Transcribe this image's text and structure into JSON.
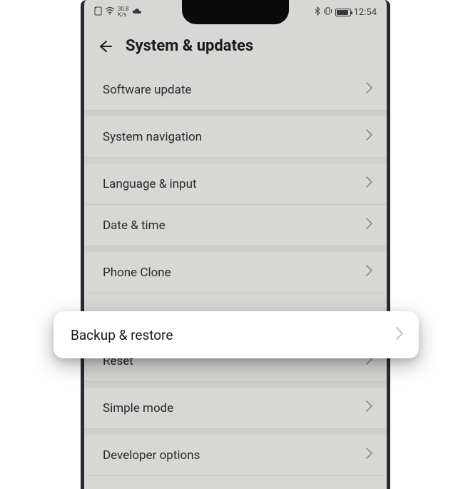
{
  "status": {
    "speed_top": "30.8",
    "speed_bottom": "K/s",
    "time": "12:54"
  },
  "header": {
    "title": "System & updates"
  },
  "items": [
    {
      "label": "Software update"
    },
    {
      "label": "System navigation"
    },
    {
      "label": "Language & input"
    },
    {
      "label": "Date & time"
    },
    {
      "label": "Phone Clone"
    },
    {
      "label": "Backup & restore"
    },
    {
      "label": "Reset"
    },
    {
      "label": "Simple mode"
    },
    {
      "label": "Developer options"
    }
  ]
}
